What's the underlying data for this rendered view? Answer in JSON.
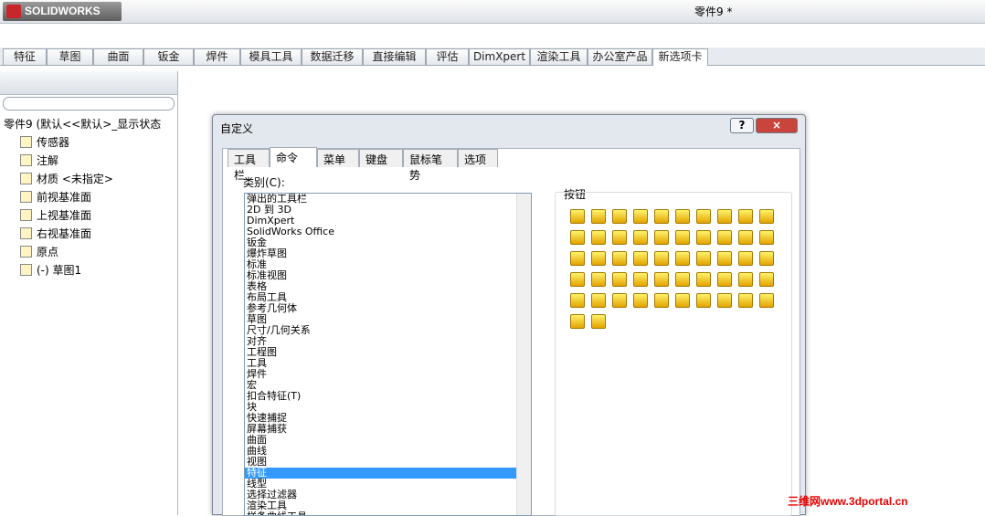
{
  "app": {
    "logo": "SOLIDWORKS",
    "title": "零件9 *"
  },
  "tabs": [
    "特征",
    "草图",
    "曲面",
    "钣金",
    "焊件",
    "模具工具",
    "数据迁移",
    "直接编辑",
    "评估",
    "DimXpert",
    "渲染工具",
    "办公室产品",
    "新选项卡"
  ],
  "tree": {
    "root": "零件9 (默认<<默认>_显示状态",
    "items": [
      "传感器",
      "注解",
      "材质 <未指定>",
      "前视基准面",
      "上视基准面",
      "右视基准面",
      "原点",
      "(-) 草图1"
    ]
  },
  "dialog": {
    "title": "自定义",
    "help": "?",
    "close": "×",
    "tabs": [
      "工具栏",
      "命令",
      "菜单",
      "键盘",
      "鼠标笔势",
      "选项"
    ],
    "category_label": "类别(C):",
    "buttons_label": "按钮",
    "categories": [
      "弹出的工具栏",
      "2D 到 3D",
      "DimXpert",
      "SolidWorks Office",
      "钣金",
      "爆炸草图",
      "标准",
      "标准视图",
      "表格",
      "布局工具",
      "参考几何体",
      "草图",
      "尺寸/几何关系",
      "对齐",
      "工程图",
      "工具",
      "焊件",
      "宏",
      "扣合特征(T)",
      "块",
      "快速捕捉",
      "屏幕捕获",
      "曲面",
      "曲线",
      "视图",
      "特征",
      "线型",
      "选择过滤器",
      "渲染工具",
      "样条曲线工具"
    ],
    "selected": "特征"
  },
  "watermark": "三维网www.3dportal.cn"
}
